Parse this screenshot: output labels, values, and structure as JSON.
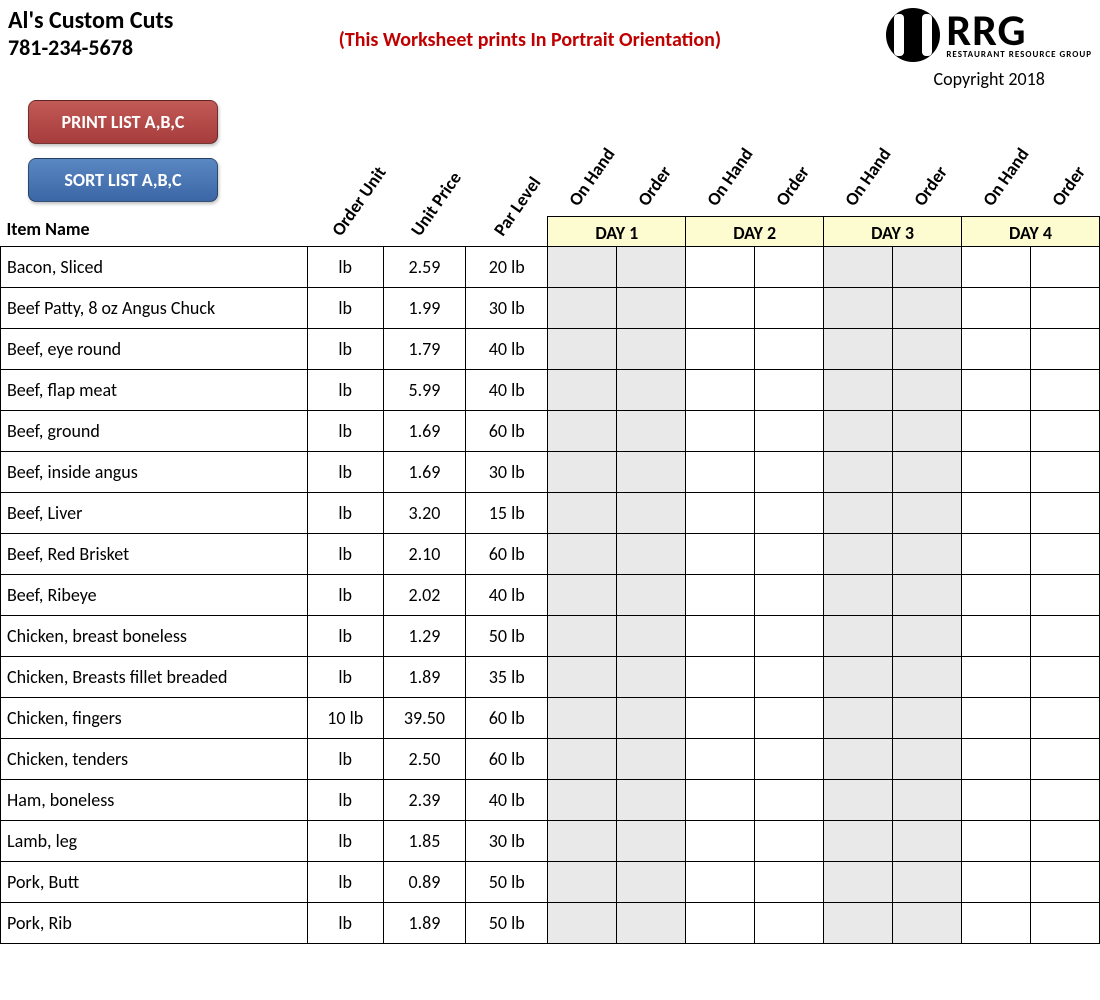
{
  "business": {
    "name": "Al's Custom Cuts",
    "phone": "781-234-5678"
  },
  "note": "(This Worksheet prints In Portrait Orientation)",
  "brand": {
    "big": "RRG",
    "sub": "RESTAURANT RESOURCE GROUP",
    "copyright": "Copyright 2018"
  },
  "buttons": {
    "print": "PRINT LIST A,B,C",
    "sort": "SORT LIST A,B,C"
  },
  "columns": {
    "item": "Item Name",
    "order_unit": "Order Unit",
    "unit_price": "Unit Price",
    "par_level": "Par Level",
    "on_hand": "On Hand",
    "order": "Order"
  },
  "days": [
    "DAY 1",
    "DAY 2",
    "DAY 3",
    "DAY 4"
  ],
  "rows": [
    {
      "name": "Bacon, Sliced",
      "unit": "lb",
      "price": "2.59",
      "par": "20 lb"
    },
    {
      "name": "Beef Patty, 8 oz Angus Chuck",
      "unit": "lb",
      "price": "1.99",
      "par": "30 lb"
    },
    {
      "name": "Beef, eye round",
      "unit": "lb",
      "price": "1.79",
      "par": "40 lb"
    },
    {
      "name": "Beef, flap meat",
      "unit": "lb",
      "price": "5.99",
      "par": "40 lb"
    },
    {
      "name": "Beef, ground",
      "unit": "lb",
      "price": "1.69",
      "par": "60 lb"
    },
    {
      "name": "Beef, inside angus",
      "unit": "lb",
      "price": "1.69",
      "par": "30 lb"
    },
    {
      "name": "Beef, Liver",
      "unit": "lb",
      "price": "3.20",
      "par": "15 lb"
    },
    {
      "name": "Beef, Red Brisket",
      "unit": "lb",
      "price": "2.10",
      "par": "60 lb"
    },
    {
      "name": "Beef, Ribeye",
      "unit": "lb",
      "price": "2.02",
      "par": "40 lb"
    },
    {
      "name": "Chicken, breast boneless",
      "unit": "lb",
      "price": "1.29",
      "par": "50 lb"
    },
    {
      "name": "Chicken, Breasts fillet breaded",
      "unit": "lb",
      "price": "1.89",
      "par": "35 lb"
    },
    {
      "name": "Chicken, fingers",
      "unit": "10 lb",
      "price": "39.50",
      "par": "60 lb"
    },
    {
      "name": "Chicken, tenders",
      "unit": "lb",
      "price": "2.50",
      "par": "60 lb"
    },
    {
      "name": "Ham, boneless",
      "unit": "lb",
      "price": "2.39",
      "par": "40 lb"
    },
    {
      "name": "Lamb, leg",
      "unit": "lb",
      "price": "1.85",
      "par": "30 lb"
    },
    {
      "name": "Pork, Butt",
      "unit": "lb",
      "price": "0.89",
      "par": "50 lb"
    },
    {
      "name": "Pork, Rib",
      "unit": "lb",
      "price": "1.89",
      "par": "50 lb"
    }
  ]
}
